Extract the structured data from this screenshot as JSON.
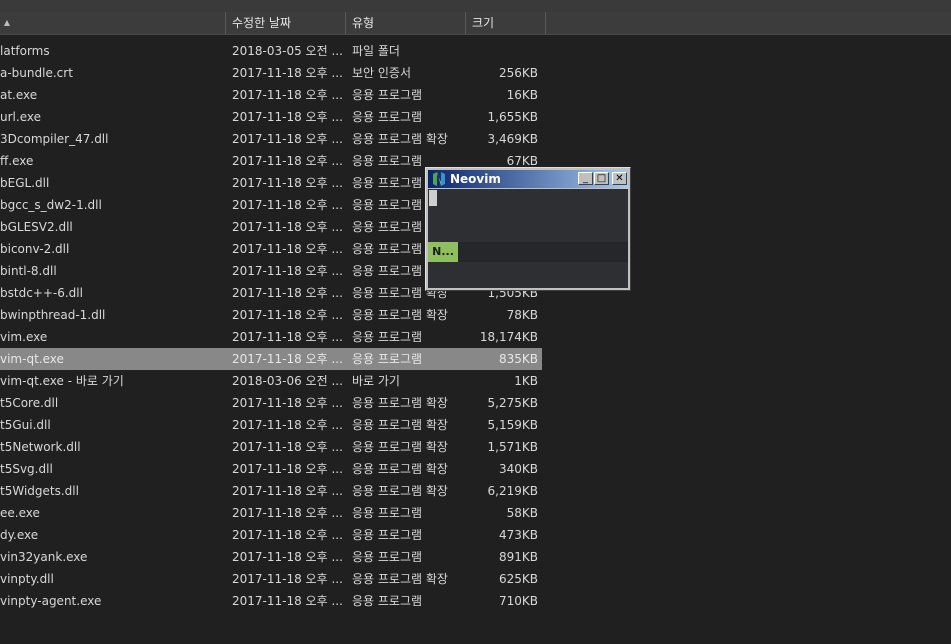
{
  "columns": {
    "name_sort_indicator": "▲",
    "date": "수정한 날짜",
    "type": "유형",
    "size": "크기"
  },
  "files": [
    {
      "name": "latforms",
      "date": "2018-03-05 오전 ...",
      "type": "파일 폴더",
      "size": ""
    },
    {
      "name": "a-bundle.crt",
      "date": "2017-11-18 오후 ...",
      "type": "보안 인증서",
      "size": "256KB"
    },
    {
      "name": "at.exe",
      "date": "2017-11-18 오후 ...",
      "type": "응용 프로그램",
      "size": "16KB"
    },
    {
      "name": "url.exe",
      "date": "2017-11-18 오후 ...",
      "type": "응용 프로그램",
      "size": "1,655KB"
    },
    {
      "name": "3Dcompiler_47.dll",
      "date": "2017-11-18 오후 ...",
      "type": "응용 프로그램 확장",
      "size": "3,469KB"
    },
    {
      "name": "ff.exe",
      "date": "2017-11-18 오후 ...",
      "type": "응용 프로그램",
      "size": "67KB"
    },
    {
      "name": "bEGL.dll",
      "date": "2017-11-18 오후 ...",
      "type": "응용 프로그램",
      "size": ""
    },
    {
      "name": "bgcc_s_dw2-1.dll",
      "date": "2017-11-18 오후 ...",
      "type": "응용 프로그램",
      "size": ""
    },
    {
      "name": "bGLESV2.dll",
      "date": "2017-11-18 오후 ...",
      "type": "응용 프로그램",
      "size": ""
    },
    {
      "name": "biconv-2.dll",
      "date": "2017-11-18 오후 ...",
      "type": "응용 프로그램",
      "size": ""
    },
    {
      "name": "bintl-8.dll",
      "date": "2017-11-18 오후 ...",
      "type": "응용 프로그램",
      "size": ""
    },
    {
      "name": "bstdc++-6.dll",
      "date": "2017-11-18 오후 ...",
      "type": "응용 프로그램 확장",
      "size": "1,505KB"
    },
    {
      "name": "bwinpthread-1.dll",
      "date": "2017-11-18 오후 ...",
      "type": "응용 프로그램 확장",
      "size": "78KB"
    },
    {
      "name": "vim.exe",
      "date": "2017-11-18 오후 ...",
      "type": "응용 프로그램",
      "size": "18,174KB"
    },
    {
      "name": "vim-qt.exe",
      "date": "2017-11-18 오후 ...",
      "type": "응용 프로그램",
      "size": "835KB",
      "selected": true
    },
    {
      "name": "vim-qt.exe - 바로 가기",
      "date": "2018-03-06 오전 ...",
      "type": "바로 가기",
      "size": "1KB"
    },
    {
      "name": "t5Core.dll",
      "date": "2017-11-18 오후 ...",
      "type": "응용 프로그램 확장",
      "size": "5,275KB"
    },
    {
      "name": "t5Gui.dll",
      "date": "2017-11-18 오후 ...",
      "type": "응용 프로그램 확장",
      "size": "5,159KB"
    },
    {
      "name": "t5Network.dll",
      "date": "2017-11-18 오후 ...",
      "type": "응용 프로그램 확장",
      "size": "1,571KB"
    },
    {
      "name": "t5Svg.dll",
      "date": "2017-11-18 오후 ...",
      "type": "응용 프로그램 확장",
      "size": "340KB"
    },
    {
      "name": "t5Widgets.dll",
      "date": "2017-11-18 오후 ...",
      "type": "응용 프로그램 확장",
      "size": "6,219KB"
    },
    {
      "name": "ee.exe",
      "date": "2017-11-18 오후 ...",
      "type": "응용 프로그램",
      "size": "58KB"
    },
    {
      "name": "dy.exe",
      "date": "2017-11-18 오후 ...",
      "type": "응용 프로그램",
      "size": "473KB"
    },
    {
      "name": "vin32yank.exe",
      "date": "2017-11-18 오후 ...",
      "type": "응용 프로그램",
      "size": "891KB"
    },
    {
      "name": "vinpty.dll",
      "date": "2017-11-18 오후 ...",
      "type": "응용 프로그램 확장",
      "size": "625KB"
    },
    {
      "name": "vinpty-agent.exe",
      "date": "2017-11-18 오후 ...",
      "type": "응용 프로그램",
      "size": "710KB"
    }
  ],
  "neovim_window": {
    "title": "Neovim",
    "minimize_glyph": "_",
    "maximize_glyph": "□",
    "close_glyph": "✕",
    "mode_label": "N..."
  },
  "colors": {
    "selected_row": "#888888",
    "mode_badge": "#8fbf5f",
    "titlebar_start": "#0a246a",
    "titlebar_end": "#a6caf0"
  }
}
